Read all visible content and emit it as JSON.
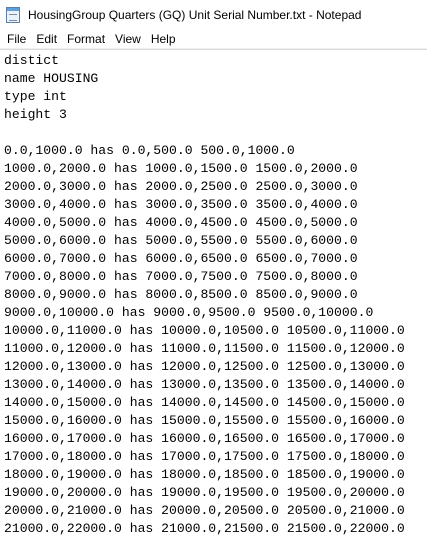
{
  "window": {
    "title": "HousingGroup Quarters (GQ) Unit Serial Number.txt - Notepad"
  },
  "menu": [
    {
      "label": "File"
    },
    {
      "label": "Edit"
    },
    {
      "label": "Format"
    },
    {
      "label": "View"
    },
    {
      "label": "Help"
    }
  ],
  "editor": {
    "lines": [
      "distict",
      "name HOUSING",
      "type int",
      "height 3",
      "",
      "0.0,1000.0 has 0.0,500.0 500.0,1000.0",
      "1000.0,2000.0 has 1000.0,1500.0 1500.0,2000.0",
      "2000.0,3000.0 has 2000.0,2500.0 2500.0,3000.0",
      "3000.0,4000.0 has 3000.0,3500.0 3500.0,4000.0",
      "4000.0,5000.0 has 4000.0,4500.0 4500.0,5000.0",
      "5000.0,6000.0 has 5000.0,5500.0 5500.0,6000.0",
      "6000.0,7000.0 has 6000.0,6500.0 6500.0,7000.0",
      "7000.0,8000.0 has 7000.0,7500.0 7500.0,8000.0",
      "8000.0,9000.0 has 8000.0,8500.0 8500.0,9000.0",
      "9000.0,10000.0 has 9000.0,9500.0 9500.0,10000.0",
      "10000.0,11000.0 has 10000.0,10500.0 10500.0,11000.0",
      "11000.0,12000.0 has 11000.0,11500.0 11500.0,12000.0",
      "12000.0,13000.0 has 12000.0,12500.0 12500.0,13000.0",
      "13000.0,14000.0 has 13000.0,13500.0 13500.0,14000.0",
      "14000.0,15000.0 has 14000.0,14500.0 14500.0,15000.0",
      "15000.0,16000.0 has 15000.0,15500.0 15500.0,16000.0",
      "16000.0,17000.0 has 16000.0,16500.0 16500.0,17000.0",
      "17000.0,18000.0 has 17000.0,17500.0 17500.0,18000.0",
      "18000.0,19000.0 has 18000.0,18500.0 18500.0,19000.0",
      "19000.0,20000.0 has 19000.0,19500.0 19500.0,20000.0",
      "20000.0,21000.0 has 20000.0,20500.0 20500.0,21000.0",
      "21000.0,22000.0 has 21000.0,21500.0 21500.0,22000.0"
    ]
  }
}
